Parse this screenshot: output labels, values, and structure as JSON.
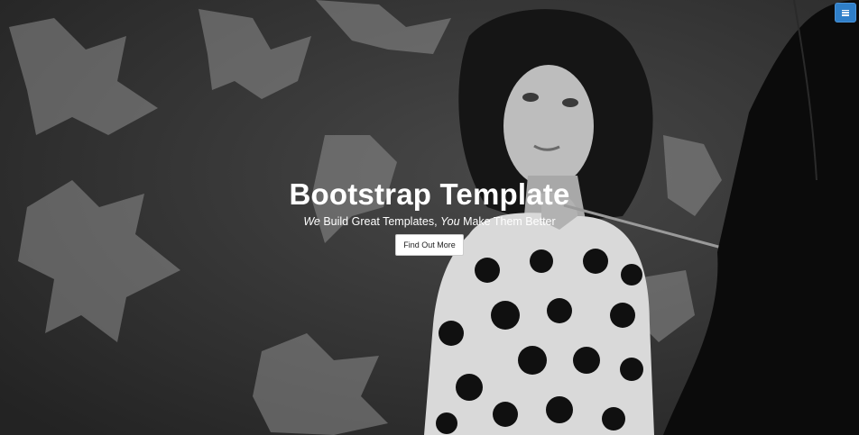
{
  "nav": {
    "menu_icon": "menu-icon",
    "accent_color": "#2f7fc9"
  },
  "hero": {
    "title": "Bootstrap Template",
    "subtitle": {
      "part1_em": "We",
      "part2": " Build Great Templates, ",
      "part3_em": "You",
      "part4": " Make Them Better"
    },
    "cta_label": "Find Out More",
    "background": "grayscale-portrait-woman-polka-dot-coat-umbrella-leaf-shadows"
  }
}
